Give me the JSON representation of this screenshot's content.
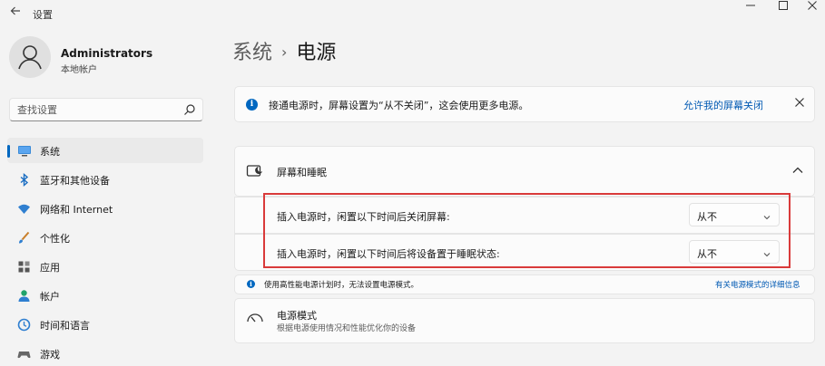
{
  "window": {
    "title": "设置",
    "back_icon": "back-arrow-icon",
    "controls": [
      "minimize-icon",
      "maximize-icon",
      "close-icon"
    ]
  },
  "user": {
    "name": "Administrators",
    "account_type": "本地帐户"
  },
  "search": {
    "placeholder": "查找设置"
  },
  "sidebar": {
    "items": [
      {
        "label": "系统",
        "icon": "monitor-icon",
        "active": true
      },
      {
        "label": "蓝牙和其他设备",
        "icon": "bluetooth-icon",
        "active": false
      },
      {
        "label": "网络和 Internet",
        "icon": "wifi-icon",
        "active": false
      },
      {
        "label": "个性化",
        "icon": "brush-icon",
        "active": false
      },
      {
        "label": "应用",
        "icon": "apps-icon",
        "active": false
      },
      {
        "label": "帐户",
        "icon": "person-icon",
        "active": false
      },
      {
        "label": "时间和语言",
        "icon": "globe-clock-icon",
        "active": false
      },
      {
        "label": "游戏",
        "icon": "gamepad-icon",
        "active": false
      }
    ]
  },
  "breadcrumb": {
    "parent": "系统",
    "separator": "›",
    "current": "电源"
  },
  "banner": {
    "text": "接通电源时，屏幕设置为“从不关闭”，这会使用更多电源。",
    "link": "允许我的屏幕关闭"
  },
  "screen_sleep": {
    "title": "屏幕和睡眠",
    "settings": [
      {
        "label": "插入电源时，闲置以下时间后关闭屏幕:",
        "value": "从不"
      },
      {
        "label": "插入电源时，闲置以下时间后将设备置于睡眠状态:",
        "value": "从不"
      }
    ]
  },
  "power_plan_note": {
    "text": "使用高性能电源计划时，无法设置电源模式。",
    "link": "有关电源模式的详细信息"
  },
  "power_mode": {
    "title": "电源模式",
    "description": "根据电源使用情况和性能优化你的设备"
  },
  "colors": {
    "accent": "#0067c0",
    "highlight_border": "#d93a3a",
    "background": "#f3f3f3",
    "card": "#fbfbfb"
  }
}
